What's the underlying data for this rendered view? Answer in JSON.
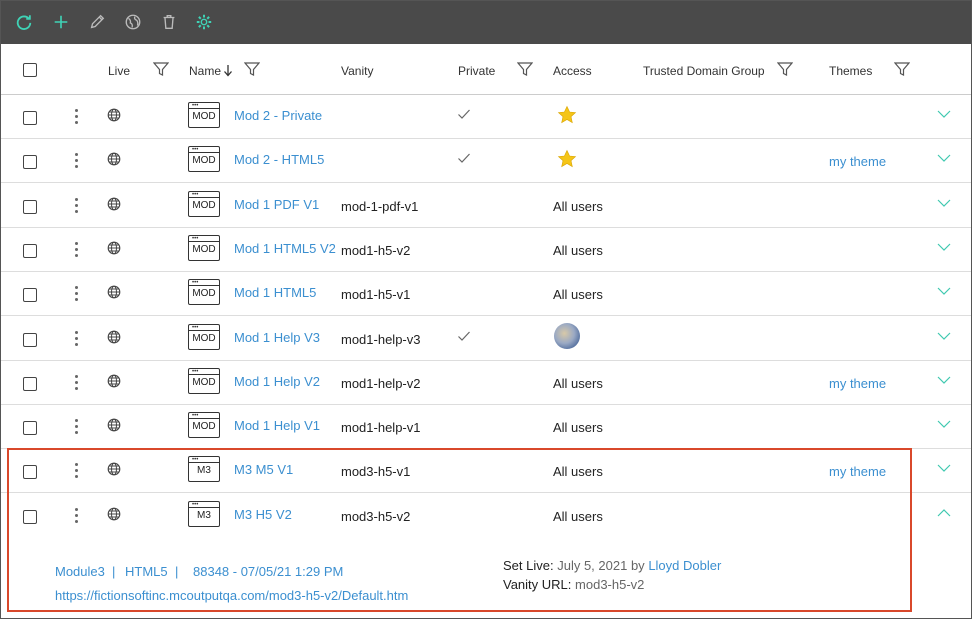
{
  "toolbar": {
    "icons": [
      "refresh-icon",
      "plus-icon",
      "pencil-icon",
      "globe-publish-icon",
      "trash-icon",
      "gear-icon"
    ],
    "accent": "#3fd3b6"
  },
  "columns": {
    "live": "Live",
    "name": "Name",
    "vanity": "Vanity",
    "private": "Private",
    "access": "Access",
    "trusted_domain_group": "Trusted Domain Group",
    "themes": "Themes"
  },
  "rows": [
    {
      "icon_label": "MOD",
      "name": "Mod 2 - Private",
      "vanity": "",
      "private": true,
      "access": "star",
      "theme": ""
    },
    {
      "icon_label": "MOD",
      "name": "Mod 2 - HTML5",
      "vanity": "",
      "private": true,
      "access": "star",
      "theme": "my theme"
    },
    {
      "icon_label": "MOD",
      "name": "Mod 1 PDF V1",
      "vanity": "mod-1-pdf-v1",
      "private": false,
      "access": "All users",
      "theme": ""
    },
    {
      "icon_label": "MOD",
      "name": "Mod 1 HTML5 V2",
      "vanity": "mod1-h5-v2",
      "private": false,
      "access": "All users",
      "theme": ""
    },
    {
      "icon_label": "MOD",
      "name": "Mod 1 HTML5",
      "vanity": "mod1-h5-v1",
      "private": false,
      "access": "All users",
      "theme": ""
    },
    {
      "icon_label": "MOD",
      "name": "Mod 1 Help V3",
      "vanity": "mod1-help-v3",
      "private": true,
      "access": "avatar",
      "theme": ""
    },
    {
      "icon_label": "MOD",
      "name": "Mod 1 Help V2",
      "vanity": "mod1-help-v2",
      "private": false,
      "access": "All users",
      "theme": "my theme"
    },
    {
      "icon_label": "MOD",
      "name": "Mod 1 Help V1",
      "vanity": "mod1-help-v1",
      "private": false,
      "access": "All users",
      "theme": ""
    },
    {
      "icon_label": "M3",
      "name": "M3 M5 V1",
      "vanity": "mod3-h5-v1",
      "private": false,
      "access": "All users",
      "theme": "my theme"
    },
    {
      "icon_label": "M3",
      "name": "M3 H5 V2",
      "vanity": "mod3-h5-v2",
      "private": false,
      "access": "All users",
      "theme": "",
      "expanded": true
    }
  ],
  "details": {
    "project": "Module3",
    "separator": "|",
    "target": "HTML5",
    "build": "88348 - 07/05/21 1:29 PM",
    "url": "https://fictionsoftinc.mcoutputqa.com/mod3-h5-v2/Default.htm",
    "set_live_label": "Set Live:",
    "set_live_date": "July 5, 2021",
    "set_live_by": "by",
    "set_live_user": "Lloyd Dobler",
    "vanity_url_label": "Vanity URL:",
    "vanity_url_value": "mod3-h5-v2"
  }
}
